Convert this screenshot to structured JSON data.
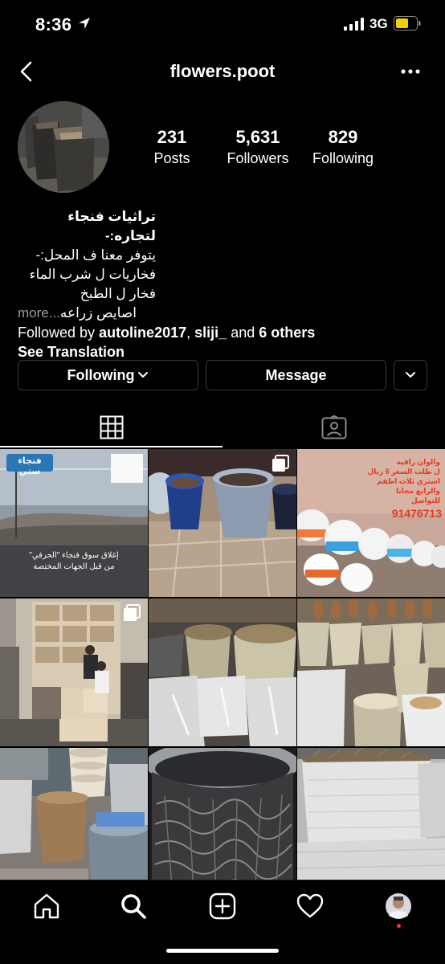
{
  "status_bar": {
    "time": "8:36",
    "network": "3G"
  },
  "nav": {
    "username": "flowers.poot"
  },
  "stats": [
    {
      "value": "231",
      "label": "Posts"
    },
    {
      "value": "5,631",
      "label": "Followers"
    },
    {
      "value": "829",
      "label": "Following"
    }
  ],
  "bio": {
    "name": "تراثيات فنجاء لتجاره:-",
    "lines": [
      "يتوفر معنا ف المحل:-",
      "فخاريات ل شرب الماء",
      "فخار ل الطبخ"
    ],
    "last_line": "اصايص زراعه",
    "ellipsis": "...",
    "more": "more",
    "followed_prefix": "Followed by",
    "followed_user1": "autoline2017",
    "followed_sep": ",",
    "followed_user2": "sliji_",
    "followed_and": "and",
    "followed_others": "6 others",
    "see_translation": "See Translation"
  },
  "buttons": {
    "following": "Following",
    "message": "Message"
  },
  "posts": [
    {
      "overlay_top": "فنجاء ستي",
      "overlay_bottom": "إغلاق سوق فنجاء \"الحرفي\"\nمن قبل الجهات المختصة",
      "multi": false
    },
    {
      "multi": true
    },
    {
      "overlay_text": "والوان راقيه\nل طلب السعر 6 ريال\nاشتري ثلاث اطقم\nوالرابع مجانا\nللتواصل",
      "overlay_number": "91476713",
      "multi": false
    },
    {
      "multi": true
    },
    {
      "multi": false
    },
    {
      "multi": false
    },
    {
      "multi": false
    },
    {
      "multi": false
    },
    {
      "multi": false
    }
  ],
  "colors": {
    "background": "#000000",
    "border": "#3a3a3a",
    "battery": "#f5d000",
    "notification_dot": "#ff3040"
  }
}
